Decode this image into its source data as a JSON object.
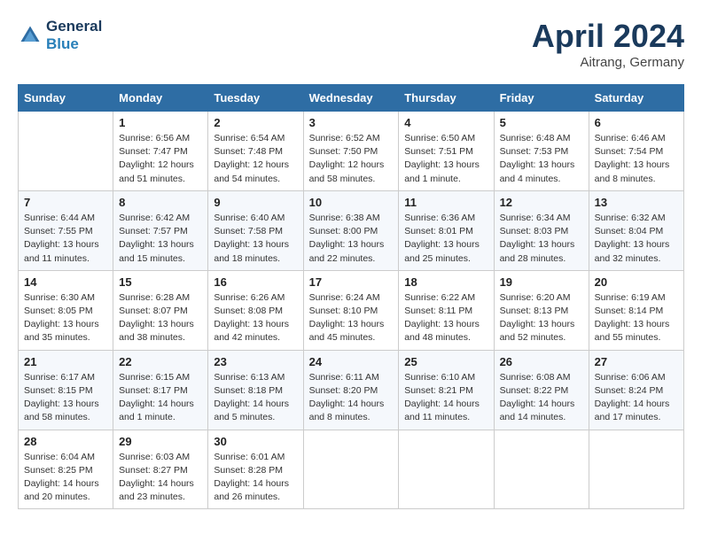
{
  "header": {
    "logo_line1": "General",
    "logo_line2": "Blue",
    "month_title": "April 2024",
    "location": "Aitrang, Germany"
  },
  "weekdays": [
    "Sunday",
    "Monday",
    "Tuesday",
    "Wednesday",
    "Thursday",
    "Friday",
    "Saturday"
  ],
  "weeks": [
    [
      {
        "day": "",
        "detail": ""
      },
      {
        "day": "1",
        "detail": "Sunrise: 6:56 AM\nSunset: 7:47 PM\nDaylight: 12 hours\nand 51 minutes."
      },
      {
        "day": "2",
        "detail": "Sunrise: 6:54 AM\nSunset: 7:48 PM\nDaylight: 12 hours\nand 54 minutes."
      },
      {
        "day": "3",
        "detail": "Sunrise: 6:52 AM\nSunset: 7:50 PM\nDaylight: 12 hours\nand 58 minutes."
      },
      {
        "day": "4",
        "detail": "Sunrise: 6:50 AM\nSunset: 7:51 PM\nDaylight: 13 hours\nand 1 minute."
      },
      {
        "day": "5",
        "detail": "Sunrise: 6:48 AM\nSunset: 7:53 PM\nDaylight: 13 hours\nand 4 minutes."
      },
      {
        "day": "6",
        "detail": "Sunrise: 6:46 AM\nSunset: 7:54 PM\nDaylight: 13 hours\nand 8 minutes."
      }
    ],
    [
      {
        "day": "7",
        "detail": "Sunrise: 6:44 AM\nSunset: 7:55 PM\nDaylight: 13 hours\nand 11 minutes."
      },
      {
        "day": "8",
        "detail": "Sunrise: 6:42 AM\nSunset: 7:57 PM\nDaylight: 13 hours\nand 15 minutes."
      },
      {
        "day": "9",
        "detail": "Sunrise: 6:40 AM\nSunset: 7:58 PM\nDaylight: 13 hours\nand 18 minutes."
      },
      {
        "day": "10",
        "detail": "Sunrise: 6:38 AM\nSunset: 8:00 PM\nDaylight: 13 hours\nand 22 minutes."
      },
      {
        "day": "11",
        "detail": "Sunrise: 6:36 AM\nSunset: 8:01 PM\nDaylight: 13 hours\nand 25 minutes."
      },
      {
        "day": "12",
        "detail": "Sunrise: 6:34 AM\nSunset: 8:03 PM\nDaylight: 13 hours\nand 28 minutes."
      },
      {
        "day": "13",
        "detail": "Sunrise: 6:32 AM\nSunset: 8:04 PM\nDaylight: 13 hours\nand 32 minutes."
      }
    ],
    [
      {
        "day": "14",
        "detail": "Sunrise: 6:30 AM\nSunset: 8:05 PM\nDaylight: 13 hours\nand 35 minutes."
      },
      {
        "day": "15",
        "detail": "Sunrise: 6:28 AM\nSunset: 8:07 PM\nDaylight: 13 hours\nand 38 minutes."
      },
      {
        "day": "16",
        "detail": "Sunrise: 6:26 AM\nSunset: 8:08 PM\nDaylight: 13 hours\nand 42 minutes."
      },
      {
        "day": "17",
        "detail": "Sunrise: 6:24 AM\nSunset: 8:10 PM\nDaylight: 13 hours\nand 45 minutes."
      },
      {
        "day": "18",
        "detail": "Sunrise: 6:22 AM\nSunset: 8:11 PM\nDaylight: 13 hours\nand 48 minutes."
      },
      {
        "day": "19",
        "detail": "Sunrise: 6:20 AM\nSunset: 8:13 PM\nDaylight: 13 hours\nand 52 minutes."
      },
      {
        "day": "20",
        "detail": "Sunrise: 6:19 AM\nSunset: 8:14 PM\nDaylight: 13 hours\nand 55 minutes."
      }
    ],
    [
      {
        "day": "21",
        "detail": "Sunrise: 6:17 AM\nSunset: 8:15 PM\nDaylight: 13 hours\nand 58 minutes."
      },
      {
        "day": "22",
        "detail": "Sunrise: 6:15 AM\nSunset: 8:17 PM\nDaylight: 14 hours\nand 1 minute."
      },
      {
        "day": "23",
        "detail": "Sunrise: 6:13 AM\nSunset: 8:18 PM\nDaylight: 14 hours\nand 5 minutes."
      },
      {
        "day": "24",
        "detail": "Sunrise: 6:11 AM\nSunset: 8:20 PM\nDaylight: 14 hours\nand 8 minutes."
      },
      {
        "day": "25",
        "detail": "Sunrise: 6:10 AM\nSunset: 8:21 PM\nDaylight: 14 hours\nand 11 minutes."
      },
      {
        "day": "26",
        "detail": "Sunrise: 6:08 AM\nSunset: 8:22 PM\nDaylight: 14 hours\nand 14 minutes."
      },
      {
        "day": "27",
        "detail": "Sunrise: 6:06 AM\nSunset: 8:24 PM\nDaylight: 14 hours\nand 17 minutes."
      }
    ],
    [
      {
        "day": "28",
        "detail": "Sunrise: 6:04 AM\nSunset: 8:25 PM\nDaylight: 14 hours\nand 20 minutes."
      },
      {
        "day": "29",
        "detail": "Sunrise: 6:03 AM\nSunset: 8:27 PM\nDaylight: 14 hours\nand 23 minutes."
      },
      {
        "day": "30",
        "detail": "Sunrise: 6:01 AM\nSunset: 8:28 PM\nDaylight: 14 hours\nand 26 minutes."
      },
      {
        "day": "",
        "detail": ""
      },
      {
        "day": "",
        "detail": ""
      },
      {
        "day": "",
        "detail": ""
      },
      {
        "day": "",
        "detail": ""
      }
    ]
  ]
}
